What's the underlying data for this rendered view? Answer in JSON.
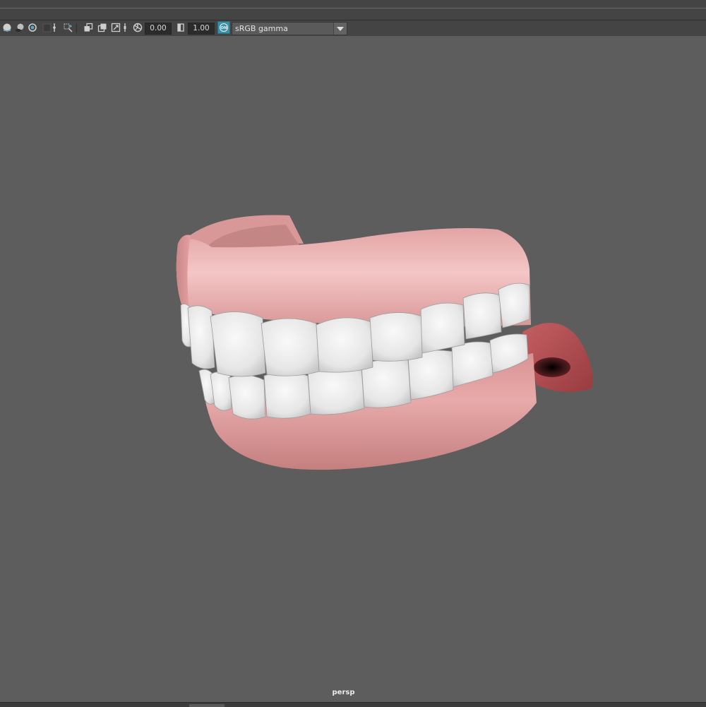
{
  "toolbar": {
    "icons": [
      "lighting-icon",
      "shadows-icon",
      "ambient-occlusion-icon",
      "motion-blur-icon",
      "anti-alias-icon",
      "depth-of-field-icon",
      "isolate-select-icon",
      "xray-icon",
      "xray-joints-icon",
      "xray-active-icon",
      "exposure-icon",
      "gamma-icon",
      "color-management-icon"
    ],
    "exposure_value": "0.00",
    "gamma_value": "1.00",
    "color_management_badge": "ON",
    "color_space": "sRGB gamma"
  },
  "viewport": {
    "camera": "persp"
  },
  "colors": {
    "gum": "#dc9a9a",
    "tooth": "#eeeeee",
    "tongue": "#b65457",
    "background": "#5d5d5d"
  }
}
